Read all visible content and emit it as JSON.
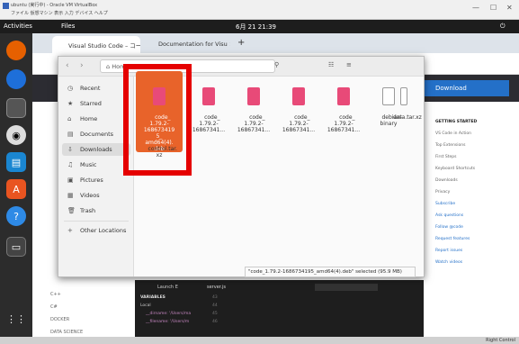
{
  "vbox": {
    "title": "ubuntu (実行中) - Oracle VM VirtualBox",
    "menu": "ファイル  仮想マシン  表示  入力  デバイス  ヘルプ",
    "min": "—",
    "max": "☐",
    "close": "✕"
  },
  "topbar": {
    "activities": "Activities",
    "app": "Files",
    "clock": "6月 21 21:39",
    "tray": "⏻"
  },
  "browser": {
    "tabs": [
      {
        "label": "Visual Studio Code – コー ×"
      },
      {
        "label": "Documentation for Visu ×"
      }
    ],
    "new_tab": "+",
    "download_label": "Download",
    "right_links": [
      "GETTING STARTED",
      "VS Code in Action",
      "Top Extensions",
      "First Steps",
      "Keyboard Shortcuts",
      "Downloads",
      "Privacy"
    ],
    "community": [
      "Subscribe",
      "Ask questions",
      "Follow @code",
      "Request features",
      "Report issues",
      "Watch videos"
    ],
    "left_labels": [
      "C++",
      "C#",
      "DOCKER",
      "DATA SCIENCE"
    ]
  },
  "files": {
    "back": "‹",
    "fwd": "›",
    "path_home": "Home",
    "path_downloads": "Downloads",
    "sidebar": [
      {
        "icon": "clock-icon",
        "glyph": "◷",
        "label": "Recent"
      },
      {
        "icon": "star-icon",
        "glyph": "★",
        "label": "Starred"
      },
      {
        "icon": "home-icon",
        "glyph": "⌂",
        "label": "Home"
      },
      {
        "icon": "document-icon",
        "glyph": "▤",
        "label": "Documents"
      },
      {
        "icon": "download-icon",
        "glyph": "⇩",
        "label": "Downloads"
      },
      {
        "icon": "music-icon",
        "glyph": "♫",
        "label": "Music"
      },
      {
        "icon": "picture-icon",
        "glyph": "▣",
        "label": "Pictures"
      },
      {
        "icon": "video-icon",
        "glyph": "▦",
        "label": "Videos"
      },
      {
        "icon": "trash-icon",
        "glyph": "🗑",
        "label": "Trash"
      },
      {
        "icon": "plus-icon",
        "glyph": "+",
        "label": "Other Locations"
      }
    ],
    "items": [
      {
        "name": "code_\n1.79.2-\n168673419\n5_\namd64(4).\ndeb",
        "selected": true
      },
      {
        "name": "code_\n1.79.2-\n16867341...",
        "selected": false
      },
      {
        "name": "code_\n1.79.2-\n16867341...",
        "selected": false
      },
      {
        "name": "code_\n1.79.2-\n16867341...",
        "selected": false
      },
      {
        "name": "code_\n1.79.2-\n16867341...",
        "selected": false
      },
      {
        "name": "debian-\nbinary",
        "selected": false
      },
      {
        "name": "data.tar.xz",
        "selected": false
      },
      {
        "name": "control.tar.\nxz",
        "selected": false
      }
    ],
    "status": "\"code_1.79.2-1686734195_amd64(4).deb\" selected (95.9 MB)"
  },
  "terminal": {
    "launch": "Launch E",
    "variables": "VARIABLES",
    "local": "Local",
    "server": "server.js",
    "lines": [
      "__dirname: '/Users/ma",
      "__filename: '/Users/m"
    ],
    "nums": [
      "43",
      "44",
      "45",
      "46"
    ]
  },
  "vbstatus": "Right Control"
}
